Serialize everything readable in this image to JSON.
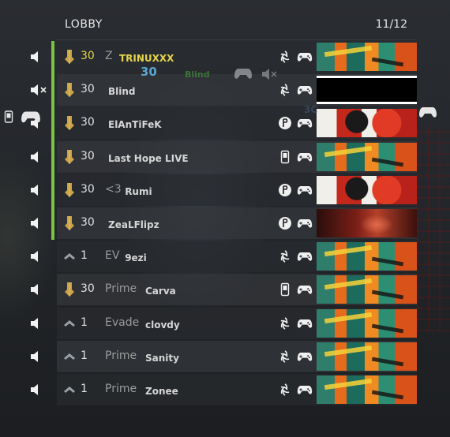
{
  "lobby": {
    "title": "LOBBY",
    "count": "11/12"
  },
  "colors": {
    "accent_bar": "#7cc243",
    "highlight_text": "#e3d44a",
    "text": "#d6d6d6",
    "muted_text": "#9b9b9b"
  },
  "overlay": {
    "level": "30",
    "name": "Blind",
    "tag": "3C"
  },
  "players": [
    {
      "muted": false,
      "rank_icon": "gold-rank-icon",
      "level": "30",
      "clan": "Z",
      "name": "TRINUXXX",
      "platform": "battlenet-icon",
      "card": "tiger",
      "highlight": true
    },
    {
      "muted": true,
      "rank_icon": "gold-rank-icon",
      "level": "30",
      "clan": "",
      "name": "Blind",
      "platform": "battlenet-icon",
      "card": "black"
    },
    {
      "muted": false,
      "rank_icon": "gold-rank-icon",
      "level": "30",
      "clan": "",
      "name": "ElAnTiFeK",
      "platform": "playstation-icon",
      "card": "splash"
    },
    {
      "muted": false,
      "rank_icon": "gold-rank-icon",
      "level": "30",
      "clan": "",
      "name": "Last Hope LIVE",
      "platform": "phone-icon",
      "card": "tiger"
    },
    {
      "muted": false,
      "rank_icon": "gold-rank-icon",
      "level": "30",
      "clan": "<3",
      "name": "Rumi",
      "platform": "playstation-icon",
      "card": "splash"
    },
    {
      "muted": false,
      "rank_icon": "gold-rank-icon",
      "level": "30",
      "clan": "",
      "name": "ZeaLFlipz",
      "platform": "playstation-icon",
      "card": "demon"
    },
    {
      "muted": false,
      "rank_icon": "chevron-rank-icon",
      "level": "1",
      "clan": "EV",
      "name": "9ezi",
      "platform": "battlenet-icon",
      "card": "tiger"
    },
    {
      "muted": false,
      "rank_icon": "gold-rank-icon",
      "level": "30",
      "clan": "Prime",
      "name": "Carva",
      "platform": "phone-icon",
      "card": "tiger"
    },
    {
      "muted": false,
      "rank_icon": "chevron-rank-icon",
      "level": "1",
      "clan": "Evade",
      "name": "clovdy",
      "platform": "battlenet-icon",
      "card": "tiger"
    },
    {
      "muted": false,
      "rank_icon": "chevron-rank-icon",
      "level": "1",
      "clan": "Prime",
      "name": "Sanity",
      "platform": "battlenet-icon",
      "card": "tiger"
    },
    {
      "muted": false,
      "rank_icon": "chevron-rank-icon",
      "level": "1",
      "clan": "Prime",
      "name": "Zonee",
      "platform": "battlenet-icon",
      "card": "tiger"
    }
  ]
}
